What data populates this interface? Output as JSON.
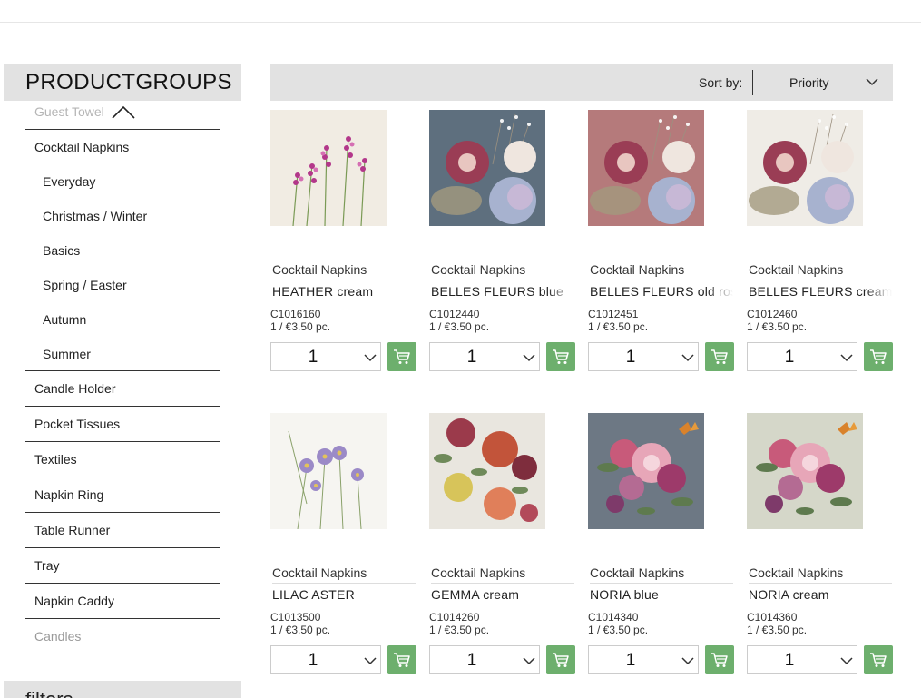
{
  "sidebar": {
    "title": "PRODUCTGROUPS",
    "items": [
      {
        "label": "Guest Towel",
        "kind": "faded"
      },
      {
        "label": "Cocktail Napkins",
        "kind": "main-open"
      },
      {
        "label": "Everyday",
        "kind": "sub"
      },
      {
        "label": "Christmas / Winter",
        "kind": "sub"
      },
      {
        "label": "Basics",
        "kind": "sub"
      },
      {
        "label": "Spring / Easter",
        "kind": "sub"
      },
      {
        "label": "Autumn",
        "kind": "sub"
      },
      {
        "label": "Summer",
        "kind": "sub-last"
      },
      {
        "label": "Candle Holder",
        "kind": "main"
      },
      {
        "label": "Pocket Tissues",
        "kind": "main"
      },
      {
        "label": "Textiles",
        "kind": "main"
      },
      {
        "label": "Napkin Ring",
        "kind": "main"
      },
      {
        "label": "Table Runner",
        "kind": "main"
      },
      {
        "label": "Tray",
        "kind": "main"
      },
      {
        "label": "Napkin Caddy",
        "kind": "main"
      },
      {
        "label": "Candles",
        "kind": "bottom-faded"
      }
    ],
    "filters_title": "filters"
  },
  "sort": {
    "label": "Sort by:",
    "value": "Priority"
  },
  "products": [
    {
      "category": "Cocktail Napkins",
      "name": "HEATHER cream",
      "code": "C1016160",
      "price": "1 / €3.50 pc.",
      "qty": "1",
      "image": "heather"
    },
    {
      "category": "Cocktail Napkins",
      "name": "BELLES FLEURS blue",
      "code": "C1012440",
      "price": "1 / €3.50 pc.",
      "qty": "1",
      "image": "belles-blue"
    },
    {
      "category": "Cocktail Napkins",
      "name": "BELLES FLEURS old rose",
      "code": "C1012451",
      "price": "1 / €3.50 pc.",
      "qty": "1",
      "image": "belles-rose"
    },
    {
      "category": "Cocktail Napkins",
      "name": "BELLES FLEURS cream",
      "code": "C1012460",
      "price": "1 / €3.50 pc.",
      "qty": "1",
      "image": "belles-cream"
    },
    {
      "category": "Cocktail Napkins",
      "name": "LILAC ASTER",
      "code": "C1013500",
      "price": "1 / €3.50 pc.",
      "qty": "1",
      "image": "lilac-aster"
    },
    {
      "category": "Cocktail Napkins",
      "name": "GEMMA cream",
      "code": "C1014260",
      "price": "1 / €3.50 pc.",
      "qty": "1",
      "image": "gemma"
    },
    {
      "category": "Cocktail Napkins",
      "name": "NORIA blue",
      "code": "C1014340",
      "price": "1 / €3.50 pc.",
      "qty": "1",
      "image": "noria-blue"
    },
    {
      "category": "Cocktail Napkins",
      "name": "NORIA cream",
      "code": "C1014360",
      "price": "1 / €3.50 pc.",
      "qty": "1",
      "image": "noria-cream"
    }
  ],
  "colors": {
    "header_bg": "#e2e2e2",
    "cart_button": "#6daf6d",
    "divider": "#333333"
  }
}
